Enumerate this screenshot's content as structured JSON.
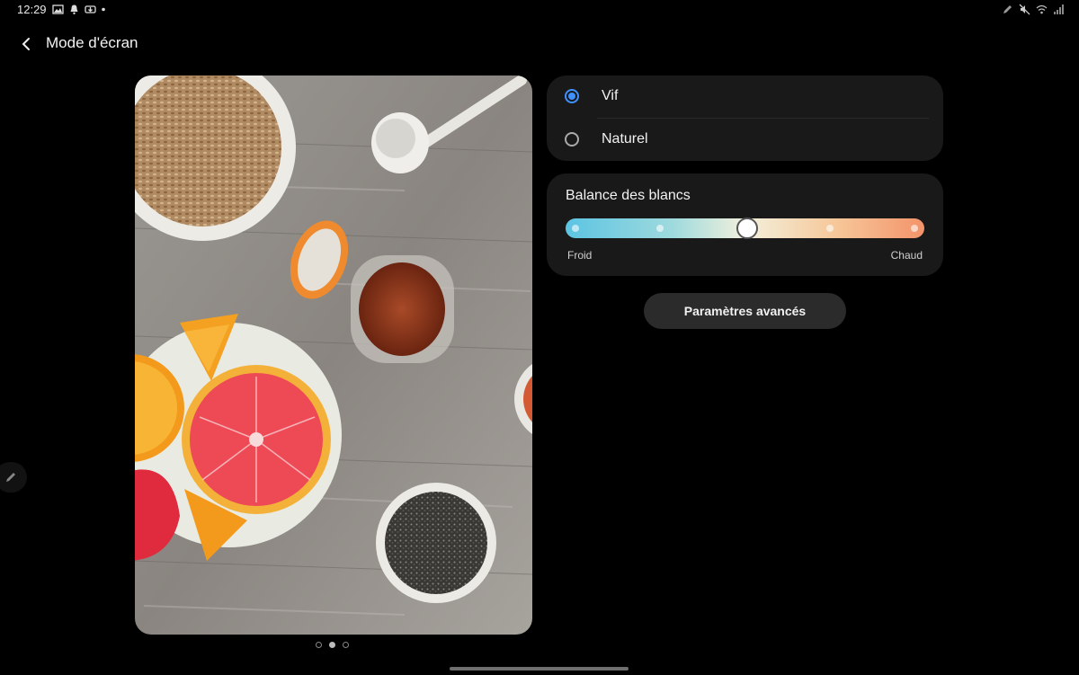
{
  "status_bar": {
    "time": "12:29",
    "left_icons": [
      "image-icon",
      "notification-bell-icon",
      "download-icon",
      "more-dot-icon"
    ],
    "right_icons": [
      "pen-icon",
      "mute-icon",
      "wifi-icon",
      "signal-icon"
    ]
  },
  "header": {
    "title": "Mode d'écran",
    "back_icon": "chevron-left-icon"
  },
  "preview": {
    "pager_total": 3,
    "pager_active_index": 1
  },
  "screen_mode": {
    "options": [
      {
        "label": "Vif",
        "selected": true
      },
      {
        "label": "Naturel",
        "selected": false
      }
    ],
    "accent_color": "#3e91ff"
  },
  "white_balance": {
    "title": "Balance des blancs",
    "min_label": "Froid",
    "max_label": "Chaud",
    "steps": 5,
    "value_step": 2,
    "gradient_colors": [
      "#5cc4e2",
      "#f2f0dc",
      "#f4936a"
    ]
  },
  "advanced_button": {
    "label": "Paramètres avancés"
  },
  "side_handle": {
    "icon": "pencil-icon"
  }
}
